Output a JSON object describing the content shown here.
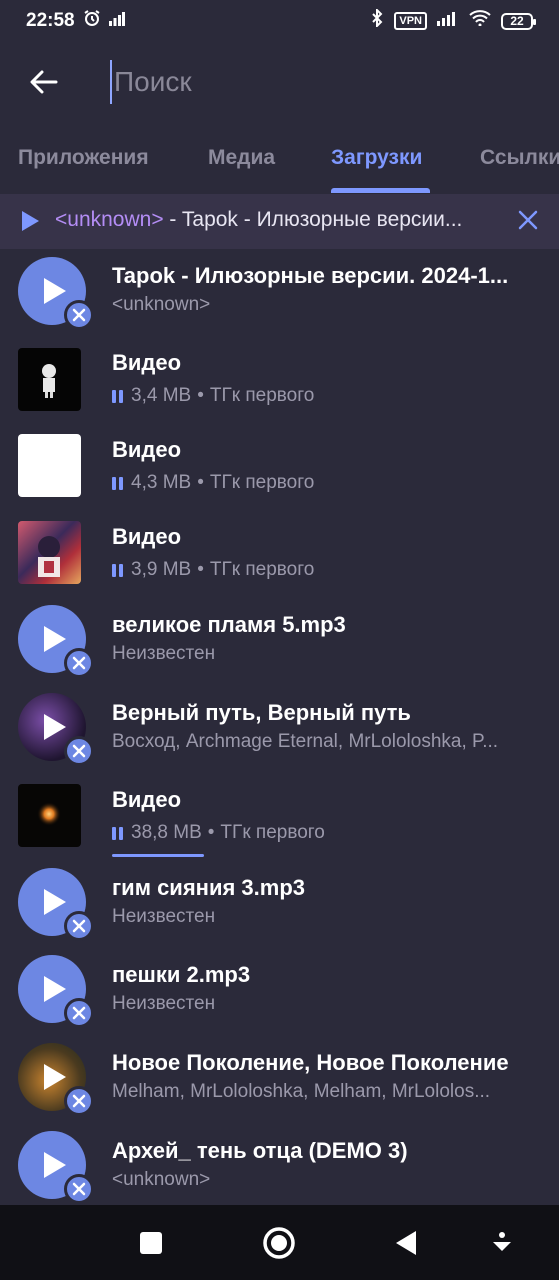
{
  "status_bar": {
    "time": "22:58",
    "vpn_label": "VPN",
    "battery_level": "22",
    "icons": [
      "alarm-icon",
      "signal-icon",
      "bluetooth-icon",
      "vpn-icon",
      "signal-icon",
      "wifi-icon",
      "battery-icon"
    ]
  },
  "search": {
    "placeholder": "Поиск",
    "value": ""
  },
  "tabs": [
    {
      "label": "Приложения",
      "active": false
    },
    {
      "label": "Медиа",
      "active": false
    },
    {
      "label": "Загрузки",
      "active": true
    },
    {
      "label": "Ссылки",
      "active": false
    }
  ],
  "player": {
    "artist": "<unknown>",
    "separator": " - ",
    "title": "Tapok - Илюзорные версии..."
  },
  "items": [
    {
      "title": "Tapok - Илюзорные версии. 2024-1...",
      "subtitle": "<unknown>",
      "kind": "audio"
    },
    {
      "title": "Видео",
      "size": "3,4 MB",
      "source": "ТГк первого",
      "kind": "video",
      "thumb": "black"
    },
    {
      "title": "Видео",
      "size": "4,3 MB",
      "source": "ТГк первого",
      "kind": "video",
      "thumb": "white"
    },
    {
      "title": "Видео",
      "size": "3,9 MB",
      "source": "ТГк первого",
      "kind": "video",
      "thumb": "art"
    },
    {
      "title": "великое пламя 5.mp3",
      "subtitle": "Неизвестен",
      "kind": "audio"
    },
    {
      "title": "Верный путь, Верный путь",
      "subtitle": "Восход, Archmage Eternal, MrLololoshka, P...",
      "kind": "audio",
      "cover": "ver"
    },
    {
      "title": "Видео",
      "size": "38,8 MB",
      "source": "ТГк первого",
      "kind": "video",
      "thumb": "dark",
      "progress": 0.23
    },
    {
      "title": "гим сияния 3.mp3",
      "subtitle": "Неизвестен",
      "kind": "audio"
    },
    {
      "title": "пешки 2.mp3",
      "subtitle": "Неизвестен",
      "kind": "audio"
    },
    {
      "title": "Новое Поколение, Новое Поколение",
      "subtitle": "Melham, MrLololoshka, Melham, MrLololos...",
      "kind": "audio",
      "cover": "nov"
    },
    {
      "title": "Архей_ тень отца (DEMO 3)",
      "subtitle": "<unknown>",
      "kind": "audio"
    }
  ],
  "separator_dot": "•",
  "colors": {
    "background": "#2b2a3a",
    "accent": "#7e98ff",
    "player_bar": "#373349",
    "artist": "#b48df5",
    "navbar": "#101015"
  }
}
